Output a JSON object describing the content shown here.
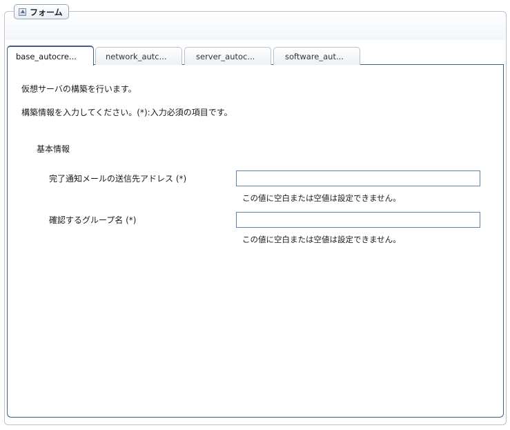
{
  "form": {
    "legend": "フォーム",
    "tabs": [
      {
        "label": "base_autocre...",
        "active": true
      },
      {
        "label": "network_autc...",
        "active": false
      },
      {
        "label": "server_autoc...",
        "active": false
      },
      {
        "label": "software_aut...",
        "active": false
      }
    ],
    "description": "仮想サーバの構築を行います。",
    "instruction": "構築情報を入力してください。(*):入力必須の項目です。",
    "section_title": "基本情報",
    "fields": [
      {
        "label": "完了通知メールの送信先アドレス (*)",
        "value": "",
        "error": "この値に空白または空値は設定できません。"
      },
      {
        "label": "確認するグループ名 (*)",
        "value": "",
        "error": "この値に空白または空値は設定できません。"
      }
    ]
  },
  "colors": {
    "accent": "#3e5f8a",
    "input_border": "#5f84b0"
  }
}
